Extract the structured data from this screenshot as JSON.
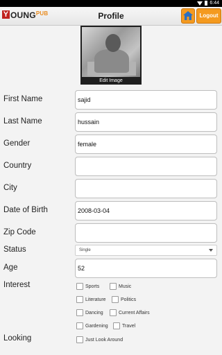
{
  "status_bar": {
    "time": "6:44"
  },
  "header": {
    "logo_letter": "Y",
    "logo_main": "OUNG",
    "logo_sub": "PUB",
    "title": "Profile",
    "logout_label": "Logout"
  },
  "photo": {
    "edit_label": "Edit Image"
  },
  "form": {
    "first_name": {
      "label": "First Name",
      "value": "sajid"
    },
    "last_name": {
      "label": "Last Name",
      "value": "hussain"
    },
    "gender": {
      "label": "Gender",
      "value": "female"
    },
    "country": {
      "label": "Country",
      "value": ""
    },
    "city": {
      "label": "City",
      "value": ""
    },
    "dob": {
      "label": "Date of Birth",
      "value": "2008-03-04"
    },
    "zip": {
      "label": "Zip Code",
      "value": ""
    },
    "status": {
      "label": "Status",
      "value": "Single"
    },
    "age": {
      "label": "Age",
      "value": "52"
    },
    "interest": {
      "label": "Interest",
      "options": [
        "Sports",
        "Music",
        "Literature",
        "Politics",
        "Dancing",
        "Current Affairs",
        "Gardening",
        "Travel"
      ]
    },
    "looking": {
      "label": "Looking",
      "options": [
        "Just Look Around"
      ]
    }
  },
  "colors": {
    "accent": "#f49a1f",
    "logo_red": "#c0221e"
  }
}
